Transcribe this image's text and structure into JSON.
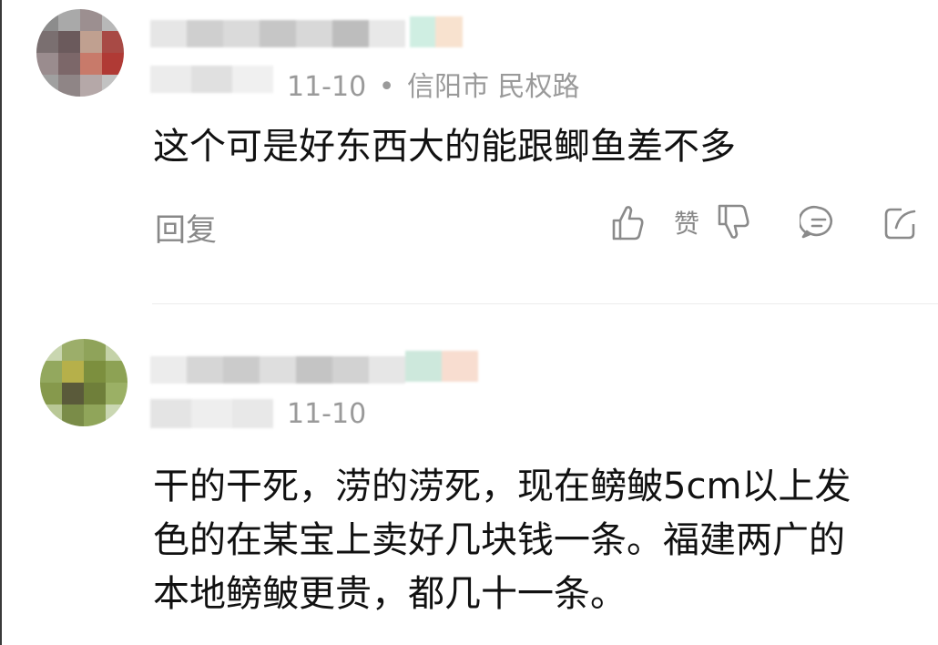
{
  "comments": [
    {
      "date": "11-10",
      "separator": "•",
      "location": "信阳市 民权路",
      "lines": [
        "这个可是好东西大的能跟鲫鱼差不多"
      ],
      "reply_label": "回复",
      "like_label": "赞"
    },
    {
      "date": "11-10",
      "lines": [
        "干的干死，涝的涝死，现在鳑鲏5cm以上发",
        "色的在某宝上卖好几块钱一条。福建两广的",
        "本地鳑鲏更贵，都几十一条。"
      ]
    }
  ],
  "icons": {
    "like": "thumbs-up-icon",
    "dislike": "thumbs-down-icon",
    "comment": "comment-icon",
    "share": "share-icon"
  },
  "colors": {
    "meta_text": "#9a9a9a",
    "body_text": "#111111",
    "action_gray": "#888888"
  }
}
